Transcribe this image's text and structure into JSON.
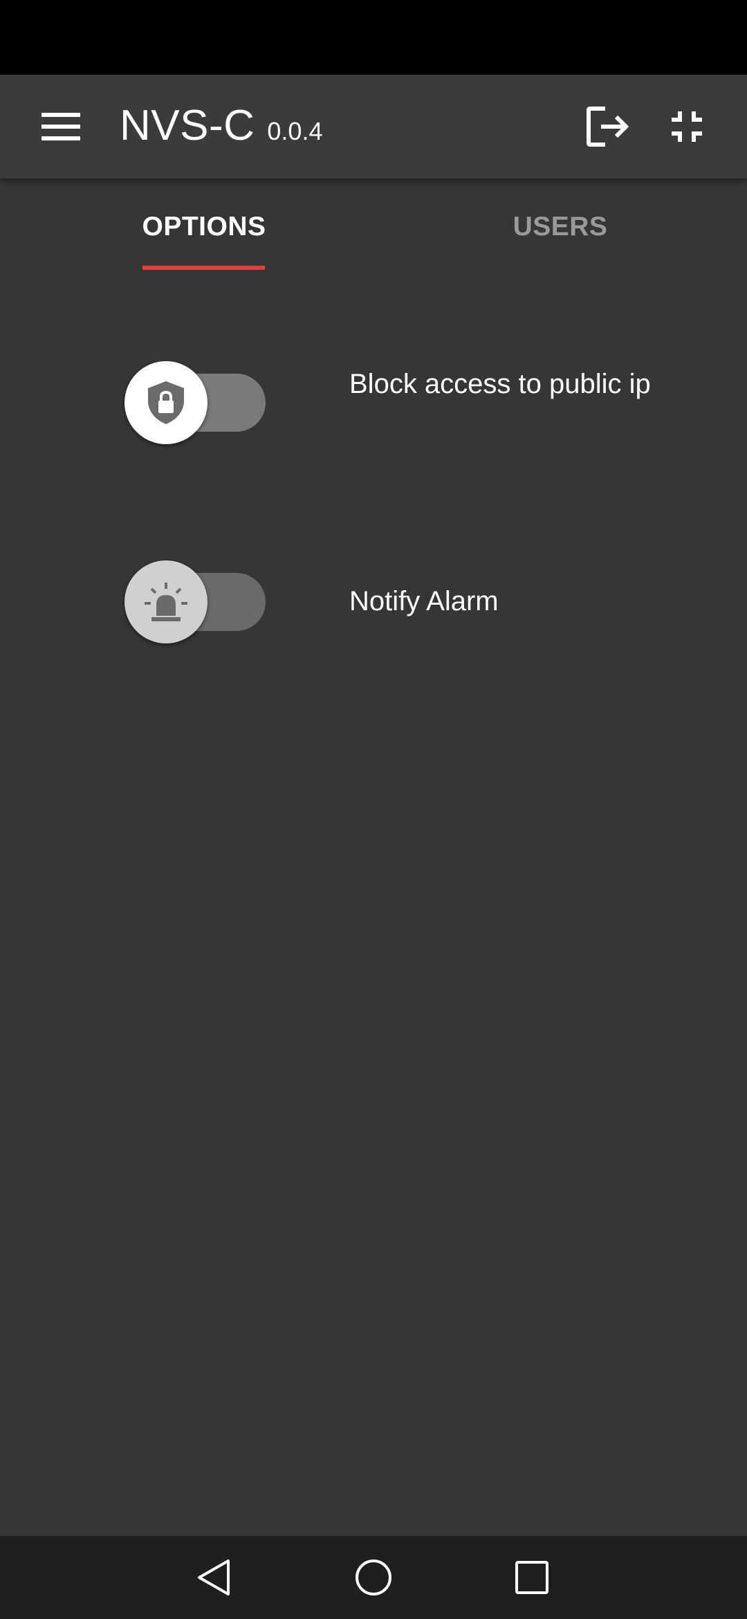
{
  "app": {
    "title": "NVS-C",
    "version": "0.0.4"
  },
  "header": {
    "menu_icon": "menu-icon",
    "logout_icon": "logout-icon",
    "exit_fullscreen_icon": "fullscreen-exit-icon"
  },
  "tabs": [
    {
      "label": "OPTIONS",
      "active": true
    },
    {
      "label": "USERS",
      "active": false
    }
  ],
  "options": [
    {
      "label": "Block access to public ip",
      "icon": "shield-lock-icon",
      "enabled": false
    },
    {
      "label": "Notify Alarm",
      "icon": "alarm-light-icon",
      "enabled": false
    }
  ],
  "colors": {
    "background": "#363636",
    "appbar": "#3b3b3b",
    "tab_indicator": "#e0413b",
    "inactive_tab": "#9a9a9a"
  },
  "navbar": {
    "back_icon": "back-triangle-icon",
    "home_icon": "home-circle-icon",
    "recents_icon": "recents-square-icon"
  }
}
